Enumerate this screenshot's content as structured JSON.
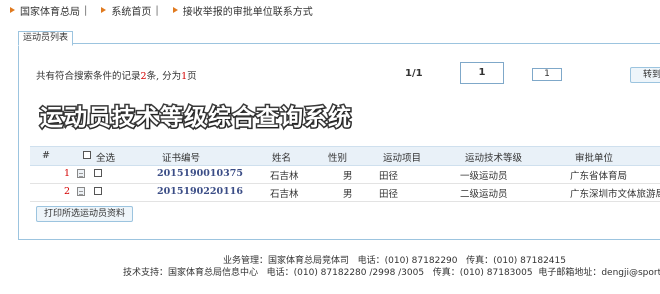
{
  "breadcrumb": {
    "item1": "国家体育总局",
    "sep1": "|",
    "item2": "系统首页",
    "sep2": "|",
    "item3": "接收举报的审批单位联系方式"
  },
  "tab": {
    "label": "运动员列表"
  },
  "pager": {
    "prefix": "共有符合搜索条件的记录",
    "count": "2",
    "mid": "条, 分为",
    "pages": "1",
    "suffix": "页",
    "page_index": "1/1",
    "current_page": "1",
    "jump_value": "1",
    "go_label": "转到"
  },
  "banner": {
    "title": "运动员技术等级综合查询系统"
  },
  "table": {
    "headers": {
      "index": "#",
      "select_all": "全选",
      "cert_no": "证书编号",
      "name": "姓名",
      "gender": "性别",
      "event": "运动项目",
      "level": "运动技术等级",
      "unit": "审批单位"
    },
    "rows": [
      {
        "index": "1",
        "cert_no": "2015190010375",
        "name": "石吉林",
        "gender": "男",
        "event": "田径",
        "level": "一级运动员",
        "unit": "广东省体育局"
      },
      {
        "index": "2",
        "cert_no": "2015190220116",
        "name": "石吉林",
        "gender": "男",
        "event": "田径",
        "level": "二级运动员",
        "unit": "广东深圳市文体旅游局"
      }
    ]
  },
  "print_button": {
    "label": "打印所选运动员资料"
  },
  "footer": {
    "line1_label": "业务管理：国家体育总局竞体司",
    "line1_tel_label": "电话：",
    "line1_tel": "(010) 87182290",
    "line1_fax_label": "传真：",
    "line1_fax": "(010) 87182415",
    "line2_label": "技术支持：国家体育总局信息中心",
    "line2_tel_label": "电话：",
    "line2_tel": "(010) 87182280 /2998 /3005",
    "line2_fax_label": "传真：",
    "line2_fax": "(010) 87183005",
    "line2_email_label": "电子邮箱地址：",
    "line2_email": "dengji@sport.gov.cn"
  },
  "colors": {
    "accent_border": "#9cc4df",
    "header_bg": "#e9f1f8",
    "count_red": "#d40000",
    "cert_blue": "#3b4d86",
    "breadcrumb_arrow": "#e07a1f"
  },
  "icons": {
    "breadcrumb": "orange-triangle-arrow",
    "row_doc": "document-icon",
    "checkbox": "checkbox"
  }
}
